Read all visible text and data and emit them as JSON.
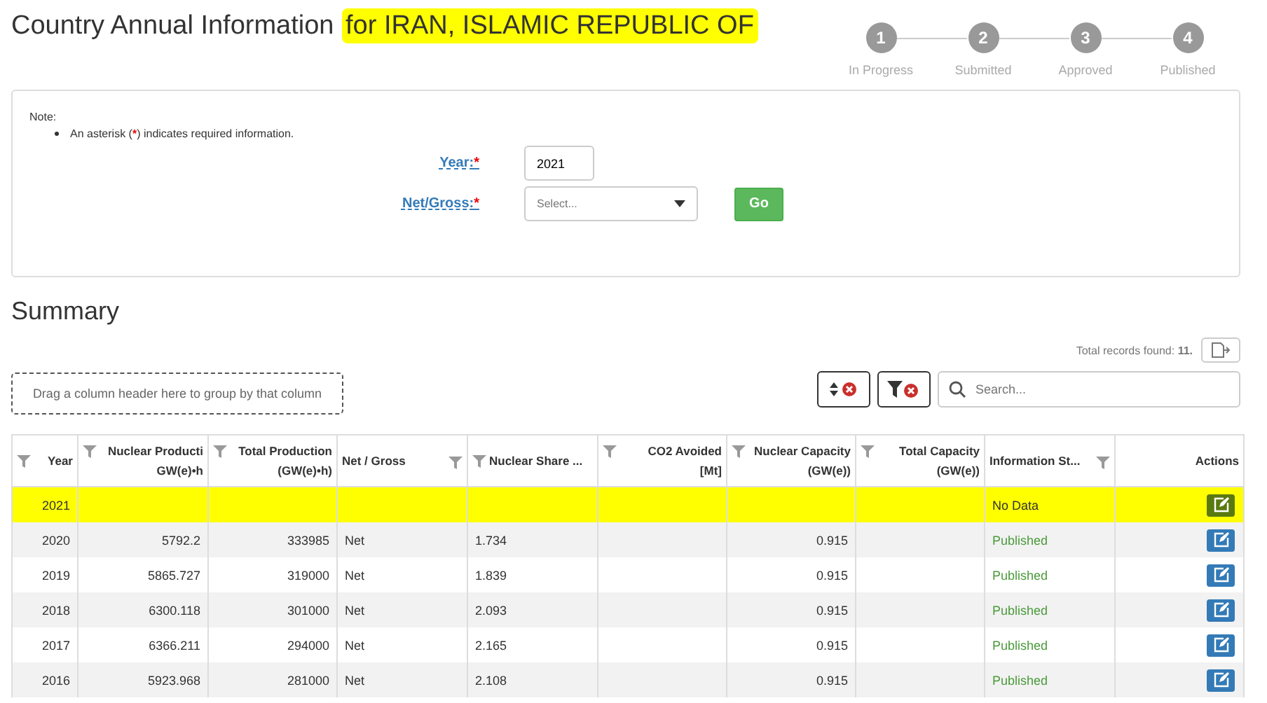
{
  "title": {
    "text": "Country Annual Information",
    "country": "for IRAN, ISLAMIC REPUBLIC OF",
    "highlighted": true
  },
  "steps": [
    {
      "number": "1",
      "label": "In Progress"
    },
    {
      "number": "2",
      "label": "Submitted"
    },
    {
      "number": "3",
      "label": "Approved"
    },
    {
      "number": "4",
      "label": "Published"
    }
  ],
  "form": {
    "note": "Note:",
    "bullet_before": "An asterisk (",
    "bullet_star": "*",
    "bullet_after": ") indicates required information.",
    "year": {
      "label": "Year:",
      "required_mark": "*",
      "value": "2021"
    },
    "net_gross": {
      "label": "Net/Gross:",
      "required_mark": "*",
      "placeholder": "Select..."
    },
    "go_button": "Go"
  },
  "summary": {
    "heading": "Summary",
    "records_label": "Total records found:",
    "records_count": "11.",
    "group_hint": "Drag a column header here to group by that column",
    "search_placeholder": "Search..."
  },
  "table": {
    "columns": [
      "Year",
      "Nuclear Producti\nGW(e)•h",
      "Total Production\n(GW(e)•h)",
      "Net / Gross",
      "Nuclear Share ...",
      "CO2 Avoided\n[Mt]",
      "Nuclear Capacity\n(GW(e))",
      "Total Capacity\n(GW(e))",
      "Information St...",
      "Actions"
    ],
    "rows": [
      {
        "cells": [
          "2021",
          "",
          "",
          "",
          "",
          "",
          "",
          "",
          "No Data"
        ],
        "published": false,
        "highlighted": true
      },
      {
        "cells": [
          "2020",
          "5792.2",
          "333985",
          "Net",
          "1.734",
          "",
          "0.915",
          "",
          "Published"
        ],
        "published": true,
        "highlighted": false
      },
      {
        "cells": [
          "2019",
          "5865.727",
          "319000",
          "Net",
          "1.839",
          "",
          "0.915",
          "",
          "Published"
        ],
        "published": true,
        "highlighted": false
      },
      {
        "cells": [
          "2018",
          "6300.118",
          "301000",
          "Net",
          "2.093",
          "",
          "0.915",
          "",
          "Published"
        ],
        "published": true,
        "highlighted": false
      },
      {
        "cells": [
          "2017",
          "6366.211",
          "294000",
          "Net",
          "2.165",
          "",
          "0.915",
          "",
          "Published"
        ],
        "published": true,
        "highlighted": false
      },
      {
        "cells": [
          "2016",
          "5923.968",
          "281000",
          "Net",
          "2.108",
          "",
          "0.915",
          "",
          "Published"
        ],
        "published": true,
        "highlighted": false
      }
    ]
  }
}
